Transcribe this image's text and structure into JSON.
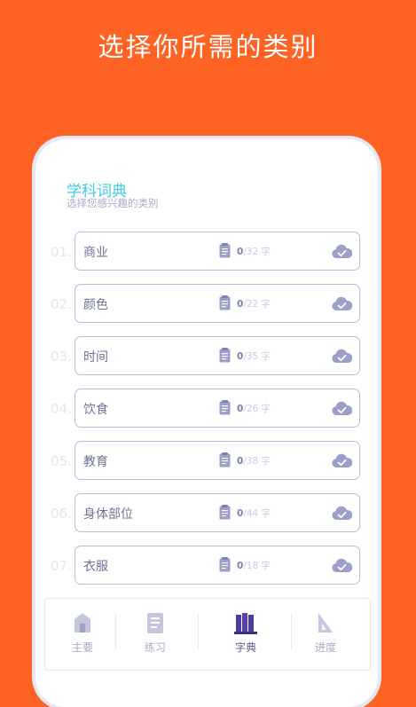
{
  "headline": "选择你所需的类别",
  "section": {
    "title": "学科词典",
    "subtitle": "选择您感兴趣的类别"
  },
  "categories": [
    {
      "index": "01.",
      "name": "商业",
      "learned": "0",
      "total": "/32 字"
    },
    {
      "index": "02.",
      "name": "颜色",
      "learned": "0",
      "total": "/22 字"
    },
    {
      "index": "03.",
      "name": "时间",
      "learned": "0",
      "total": "/35 字"
    },
    {
      "index": "04.",
      "name": "饮食",
      "learned": "0",
      "total": "/26 字"
    },
    {
      "index": "05.",
      "name": "教育",
      "learned": "0",
      "total": "/38 字"
    },
    {
      "index": "06.",
      "name": "身体部位",
      "learned": "0",
      "total": "/44 字"
    },
    {
      "index": "07.",
      "name": "衣服",
      "learned": "0",
      "total": "/18 字"
    }
  ],
  "tabs": [
    {
      "label": "主要",
      "icon": "home-icon"
    },
    {
      "label": "练习",
      "icon": "practice-icon"
    },
    {
      "label": "字典",
      "icon": "dictionary-icon",
      "active": true
    },
    {
      "label": "进度",
      "icon": "progress-icon"
    }
  ],
  "colors": {
    "background": "#FF6324",
    "accent": "#41CBE6",
    "card_border": "#B9BCDF",
    "icon": "#9C9FC8",
    "active_tab": "#5A3FA8"
  }
}
